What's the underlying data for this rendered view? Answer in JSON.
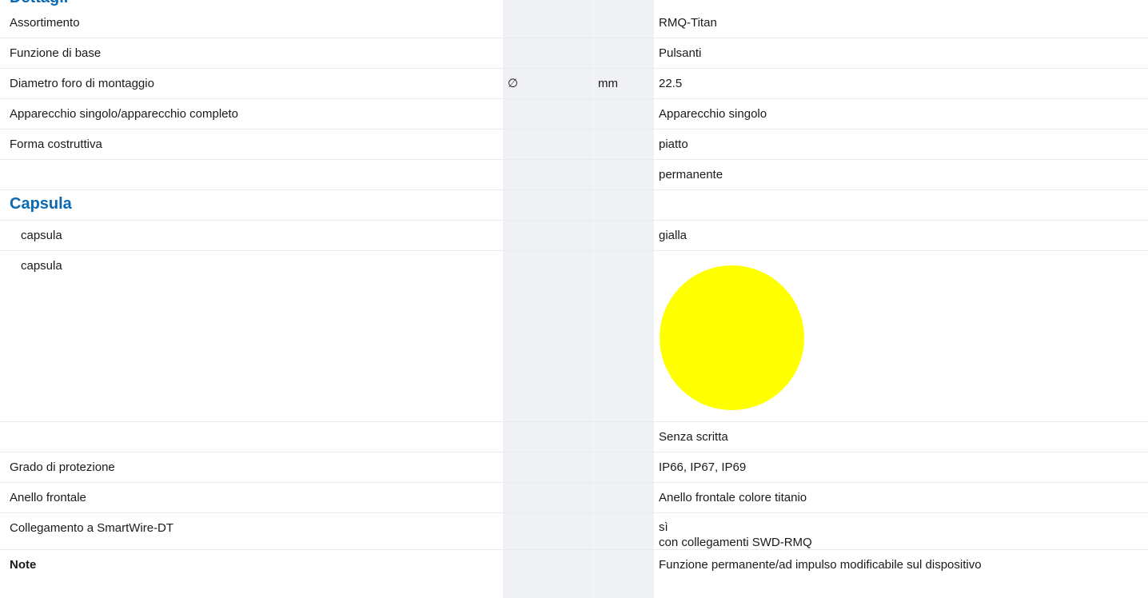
{
  "top_heading": "Dettagli",
  "rows": [
    {
      "label": "Assortimento",
      "symbol": "",
      "unit": "",
      "value": "RMQ-Titan"
    },
    {
      "label": "Funzione di base",
      "symbol": "",
      "unit": "",
      "value": "Pulsanti"
    },
    {
      "label": "Diametro foro di montaggio",
      "symbol": "∅",
      "unit": "mm",
      "value": "22.5"
    },
    {
      "label": "Apparecchio singolo/apparecchio completo",
      "symbol": "",
      "unit": "",
      "value": "Apparecchio singolo"
    },
    {
      "label": "Forma costruttiva",
      "symbol": "",
      "unit": "",
      "value": "piatto"
    },
    {
      "label": "",
      "symbol": "",
      "unit": "",
      "value": "permanente"
    }
  ],
  "section_capsula": "Capsula",
  "capsula_rows": [
    {
      "label": "capsula",
      "value": "gialla"
    },
    {
      "label": "capsula",
      "swatch_color": "#ffff00"
    }
  ],
  "rows_after": [
    {
      "label": "",
      "value": "Senza scritta"
    },
    {
      "label": "Grado di protezione",
      "value": "IP66, IP67, IP69"
    },
    {
      "label": "Anello frontale",
      "value": "Anello frontale colore titanio"
    }
  ],
  "smartwire": {
    "label": "Collegamento a SmartWire-DT",
    "value_line1": "sì",
    "value_line2": "con collegamenti SWD-RMQ"
  },
  "note": {
    "label": "Note",
    "value": "Funzione permanente/ad impulso modificabile sul dispositivo"
  },
  "colors": {
    "section_heading": "#0a6ab4",
    "unit_column_bg": "#eff1f5",
    "swatch": "#ffff00"
  }
}
